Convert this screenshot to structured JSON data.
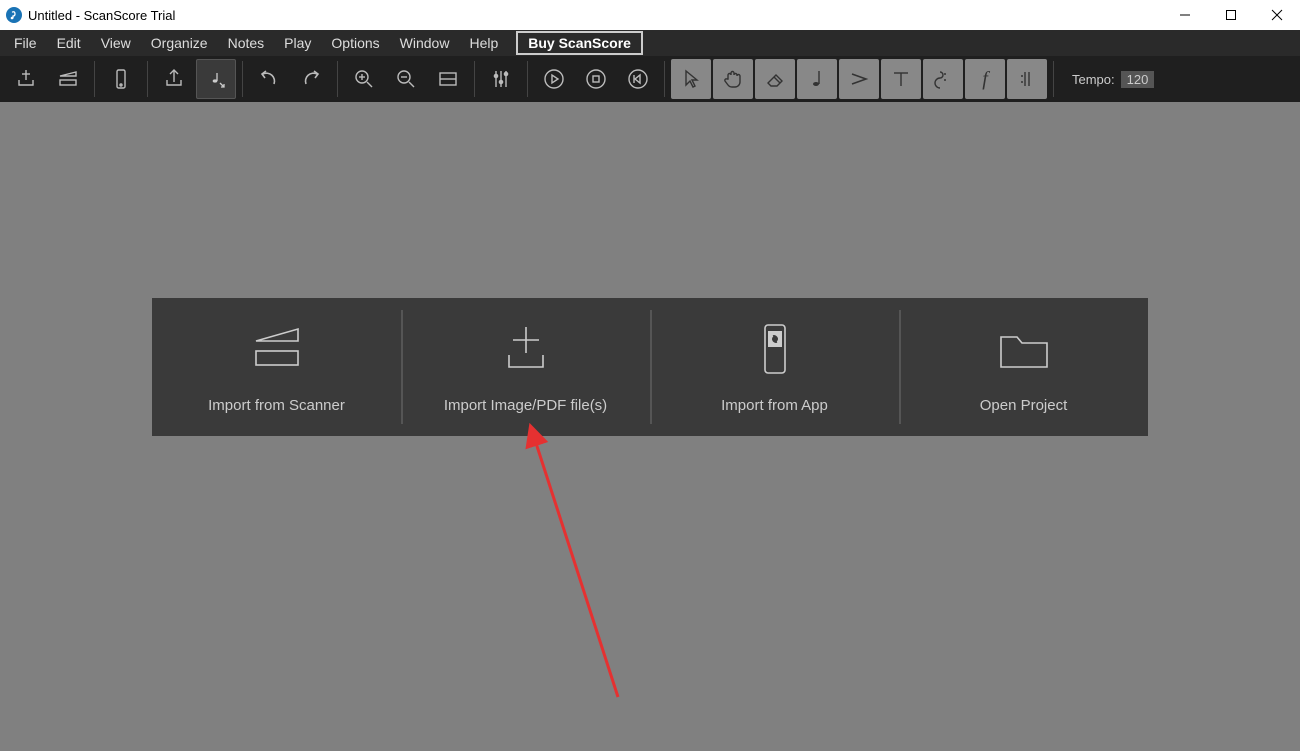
{
  "window": {
    "title": "Untitled - ScanScore Trial"
  },
  "menubar": {
    "items": [
      "File",
      "Edit",
      "View",
      "Organize",
      "Notes",
      "Play",
      "Options",
      "Window",
      "Help"
    ],
    "buy_label": "Buy ScanScore"
  },
  "toolbar": {
    "tempo_label": "Tempo:",
    "tempo_value": "120"
  },
  "welcome": {
    "tiles": [
      {
        "label": "Import from Scanner",
        "icon": "scanner-icon"
      },
      {
        "label": "Import Image/PDF file(s)",
        "icon": "import-file-icon"
      },
      {
        "label": "Import from App",
        "icon": "phone-app-icon"
      },
      {
        "label": "Open Project",
        "icon": "folder-icon"
      }
    ]
  }
}
